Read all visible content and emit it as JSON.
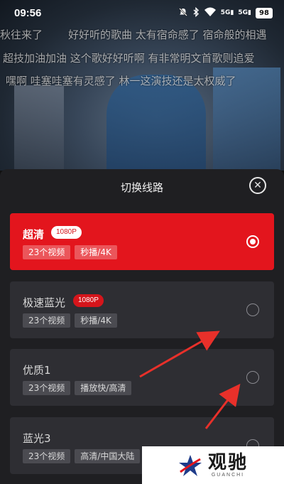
{
  "status_bar": {
    "time": "09:56",
    "icons": [
      "mute-icon",
      "bluetooth-icon",
      "wifi-icon",
      "signal-5g-icon",
      "signal-5g-icon"
    ],
    "signal_label_1": "5G",
    "signal_label_2": "5G",
    "battery": "98"
  },
  "video": {
    "danmaku": [
      "秋往来了",
      "好好听的歌曲   太有宿命感了 宿命般的相遇",
      "超技加油加油   这个歌好好听啊   有非常明文首歌则追爱",
      "嘿啊 哇塞哇塞有灵感了   林一这演技还是太权威了"
    ]
  },
  "sheet": {
    "title": "切换线路",
    "close_icon": "close-icon",
    "lines": [
      {
        "name": "超清",
        "badge": "1080P",
        "tags": [
          "23个视频",
          "秒播/4K"
        ],
        "selected": true
      },
      {
        "name": "极速蓝光",
        "badge": "1080P",
        "tags": [
          "23个视频",
          "秒播/4K"
        ],
        "selected": false
      },
      {
        "name": "优质1",
        "badge": "",
        "tags": [
          "23个视频",
          "播放快/高清"
        ],
        "selected": false
      },
      {
        "name": "蓝光3",
        "badge": "",
        "tags": [
          "23个视频",
          "高清/中国大陆"
        ],
        "selected": false
      }
    ]
  },
  "colors": {
    "accent_red": "#e3151d",
    "sheet_bg": "#1f1f22",
    "card_bg": "#2e2e33",
    "arrow_red": "#e8302a"
  },
  "watermark": {
    "logo_icon": "star-logo-icon",
    "cn": "观驰",
    "en": "GUANCHI"
  }
}
